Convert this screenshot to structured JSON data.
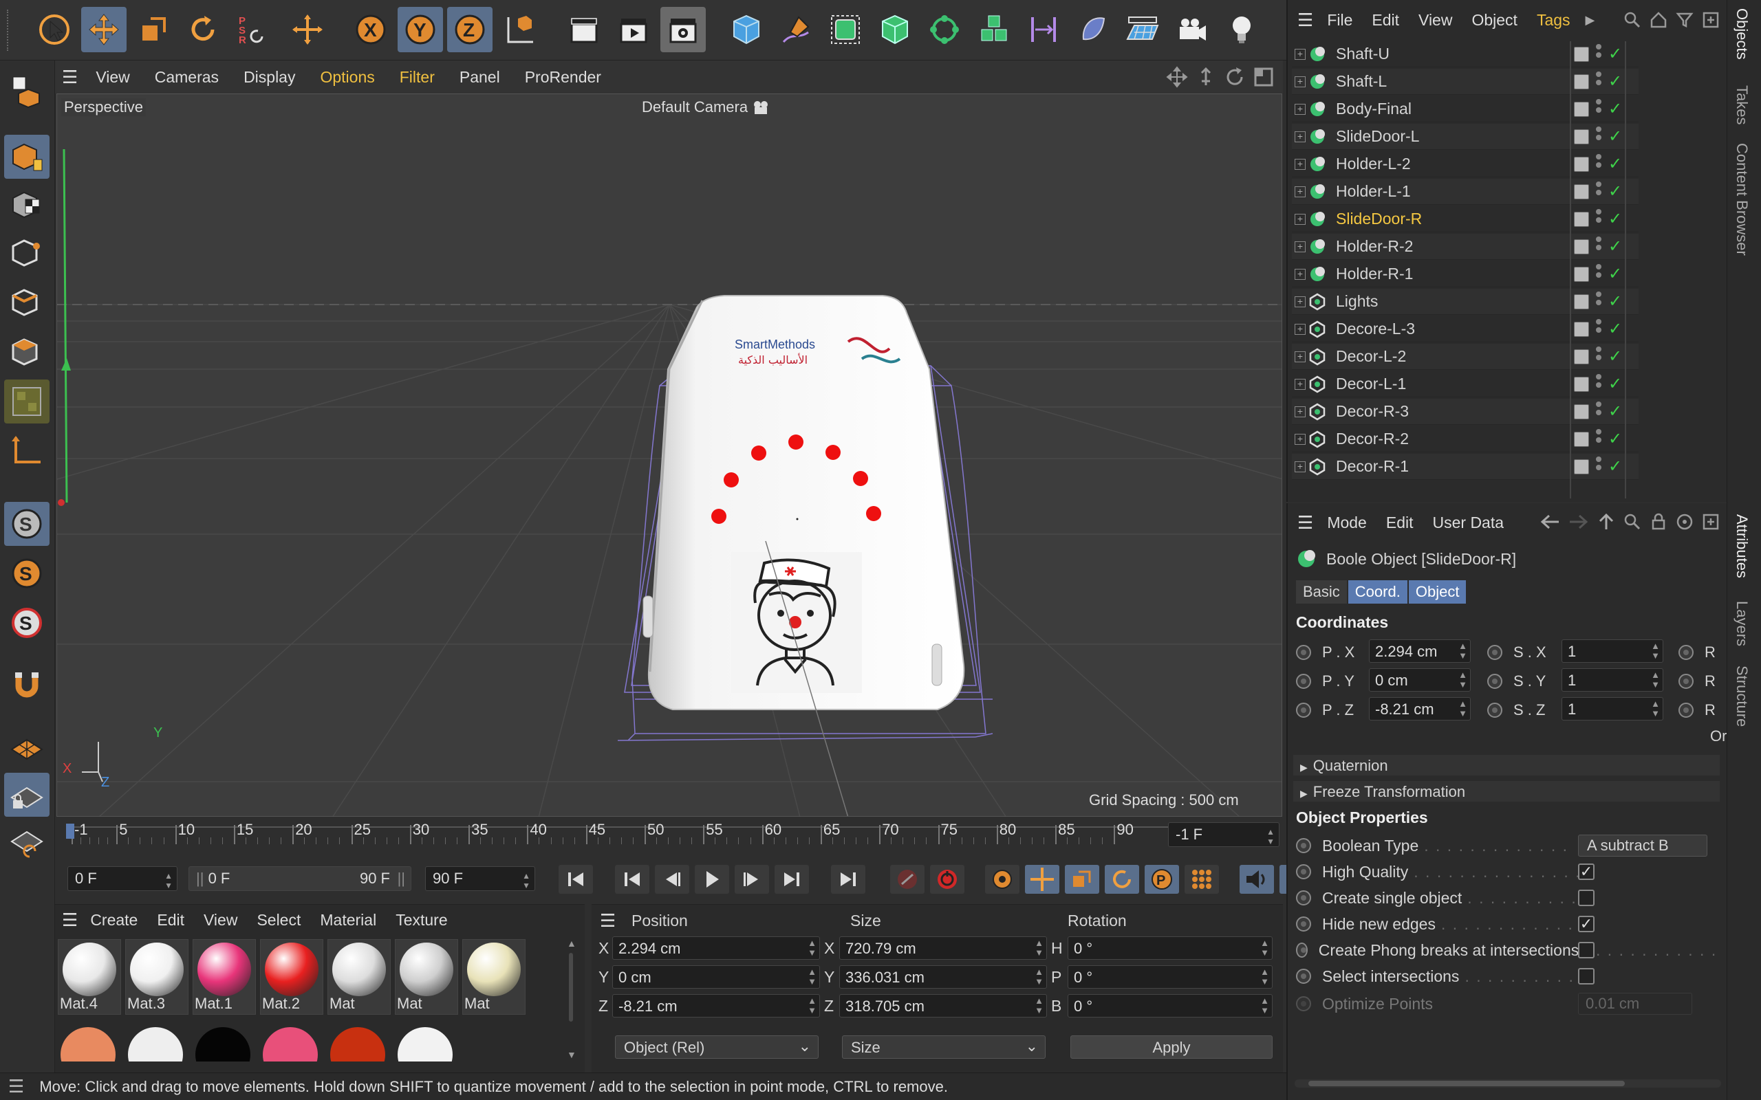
{
  "viewport_menu": [
    "View",
    "Cameras",
    "Display",
    "Options",
    "Filter",
    "Panel",
    "ProRender"
  ],
  "viewport": {
    "label": "Perspective",
    "camera": "Default Camera",
    "grid_spacing": "Grid Spacing : 500 cm",
    "logo_en": "SmartMethods",
    "logo_ar": "الأساليب الذكية",
    "axis_x": "X",
    "axis_y": "Y",
    "axis_z": "Z"
  },
  "timeline": {
    "ticks": [
      "-1",
      "5",
      "10",
      "15",
      "20",
      "25",
      "30",
      "35",
      "40",
      "45",
      "50",
      "55",
      "60",
      "65",
      "70",
      "75",
      "80",
      "85",
      "90"
    ],
    "current_frame": "-1 F",
    "start": "0 F",
    "range_start": "0 F",
    "range_end": "90 F",
    "end": "90 F"
  },
  "materials": {
    "menu": [
      "Create",
      "Edit",
      "View",
      "Select",
      "Material",
      "Texture"
    ],
    "row1": [
      {
        "name": "Mat.4",
        "color": "#e8e8e8"
      },
      {
        "name": "Mat.3",
        "color": "#f0f0f0"
      },
      {
        "name": "Mat.1",
        "color": "#e8357a"
      },
      {
        "name": "Mat.2",
        "color": "#e82020"
      },
      {
        "name": "Mat",
        "color": "#dddddd"
      },
      {
        "name": "Mat",
        "color": "#cfcfcf"
      },
      {
        "name": "Mat",
        "color": "#e8e2b8"
      }
    ]
  },
  "coords": {
    "headers": [
      "Position",
      "Size",
      "Rotation"
    ],
    "position": [
      {
        "axis": "X",
        "value": "2.294 cm"
      },
      {
        "axis": "Y",
        "value": "0 cm"
      },
      {
        "axis": "Z",
        "value": "-8.21 cm"
      }
    ],
    "size": [
      {
        "axis": "X",
        "value": "720.79 cm"
      },
      {
        "axis": "Y",
        "value": "336.031 cm"
      },
      {
        "axis": "Z",
        "value": "318.705 cm"
      }
    ],
    "rotation": [
      {
        "axis": "H",
        "value": "0 °"
      },
      {
        "axis": "P",
        "value": "0 °"
      },
      {
        "axis": "B",
        "value": "0 °"
      }
    ],
    "mode_select": "Object (Rel)",
    "size_select": "Size",
    "apply": "Apply"
  },
  "status": "Move: Click and drag to move elements. Hold down SHIFT to quantize movement / add to the selection in point mode, CTRL to remove.",
  "objects": {
    "menu": [
      "File",
      "Edit",
      "View",
      "Object",
      "Tags"
    ],
    "items": [
      {
        "name": "Shaft-U",
        "type": "boole"
      },
      {
        "name": "Shaft-L",
        "type": "boole"
      },
      {
        "name": "Body-Final",
        "type": "boole"
      },
      {
        "name": "SlideDoor-L",
        "type": "boole"
      },
      {
        "name": "Holder-L-2",
        "type": "boole"
      },
      {
        "name": "Holder-L-1",
        "type": "boole"
      },
      {
        "name": "SlideDoor-R",
        "type": "boole",
        "selected": true
      },
      {
        "name": "Holder-R-2",
        "type": "boole"
      },
      {
        "name": "Holder-R-1",
        "type": "boole"
      },
      {
        "name": "Lights",
        "type": "null"
      },
      {
        "name": "Decore-L-3",
        "type": "null"
      },
      {
        "name": "Decor-L-2",
        "type": "null"
      },
      {
        "name": "Decor-L-1",
        "type": "null"
      },
      {
        "name": "Decor-R-3",
        "type": "null"
      },
      {
        "name": "Decor-R-2",
        "type": "null"
      },
      {
        "name": "Decor-R-1",
        "type": "null"
      }
    ]
  },
  "attributes": {
    "menu": [
      "Mode",
      "Edit",
      "User Data"
    ],
    "title": "Boole Object [SlideDoor-R]",
    "tabs": [
      "Basic",
      "Coord.",
      "Object"
    ],
    "section_coords": "Coordinates",
    "p": [
      {
        "label": "P . X",
        "value": "2.294 cm"
      },
      {
        "label": "P . Y",
        "value": "0 cm"
      },
      {
        "label": "P . Z",
        "value": "-8.21 cm"
      }
    ],
    "s": [
      {
        "label": "S . X",
        "value": "1"
      },
      {
        "label": "S . Y",
        "value": "1"
      },
      {
        "label": "S . Z",
        "value": "1"
      }
    ],
    "r_label": "R",
    "overflow": "Or",
    "quaternion": "Quaternion",
    "freeze": "Freeze Transformation",
    "section_props": "Object Properties",
    "boolean_type_label": "Boolean Type",
    "boolean_type_value": "A subtract B",
    "props": [
      {
        "label": "High Quality",
        "checked": true
      },
      {
        "label": "Create single object",
        "checked": false
      },
      {
        "label": "Hide new edges",
        "checked": true
      },
      {
        "label": "Create Phong breaks at intersections",
        "checked": false
      },
      {
        "label": "Select intersections",
        "checked": false
      }
    ],
    "optimize_label": "Optimize Points",
    "optimize_value": "0.01 cm"
  },
  "side_tabs": [
    "Objects",
    "Takes",
    "Content Browser",
    "Attributes",
    "Layers",
    "Structure"
  ],
  "colors": {
    "accent": "#5a6f8c",
    "selected_text": "#f5c842",
    "check_green": "#3ed34a",
    "highlight_menu": "#f0c040"
  }
}
